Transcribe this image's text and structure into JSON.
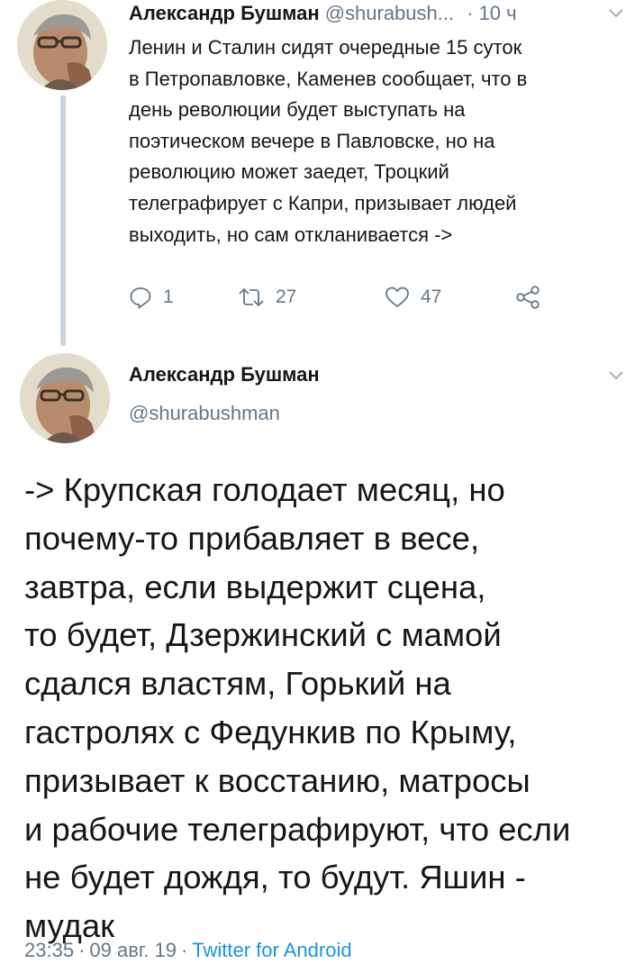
{
  "colors": {
    "text_primary": "#14171a",
    "text_secondary": "#657786",
    "link": "#1b95e0",
    "thread_line": "#c9d3dc",
    "background": "#ffffff"
  },
  "tweet1": {
    "author_name": "Александр Бушман",
    "author_handle": "@shurabush...",
    "separator": "·",
    "time": "10 ч",
    "text_lines": [
      "Ленин и Сталин сидят очередные 15 суток",
      "в Петропавловке, Каменев сообщает, что в",
      "день революции будет выступать на",
      "поэтическом вечере в Павловске, но на",
      "революцию может заедет, Троцкий",
      "телеграфирует с Капри, призывает людей",
      "выходить, но сам откланивается ->"
    ],
    "actions": {
      "reply": {
        "icon": "reply-icon",
        "count": "1"
      },
      "retweet": {
        "icon": "retweet-icon",
        "count": "27"
      },
      "like": {
        "icon": "heart-icon",
        "count": "47"
      },
      "share": {
        "icon": "share-icon"
      }
    },
    "menu_icon": "chevron-down-icon"
  },
  "tweet2": {
    "author_name": "Александр Бушман",
    "author_handle": "@shurabushman",
    "menu_icon": "chevron-down-icon",
    "text_lines": [
      "-> Крупская голодает месяц, но",
      "почему-то прибавляет в весе,",
      "завтра, если выдержит сцена,",
      "то будет, Дзержинский с мамой",
      "сдался властям, Горький на",
      "гастролях с Федункив по Крыму,",
      "призывает к восстанию, матросы",
      "и рабочие телеграфируют, что если",
      "не будет дождя, то будут. Яшин -",
      "мудак"
    ],
    "time": "23:35",
    "date": "09 авг. 19",
    "separator": "·",
    "client": "Twitter for Android"
  }
}
